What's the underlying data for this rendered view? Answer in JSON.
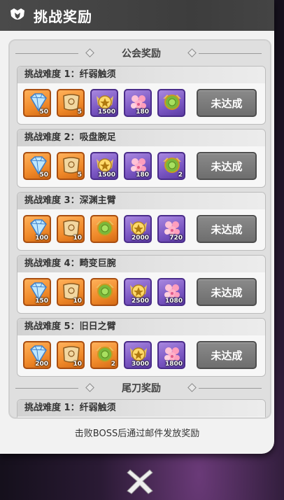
{
  "header": {
    "title": "挑战奖励",
    "icon": "guild-emblem-icon"
  },
  "sections": {
    "guild": "公会奖励",
    "last_hit": "尾刀奖励"
  },
  "cards": [
    {
      "title": "挑战难度 1：纤弱触须",
      "button": "未达成",
      "items": [
        {
          "type": "diamond",
          "q": "50",
          "c": "orange"
        },
        {
          "type": "scroll",
          "q": "5",
          "c": "orange"
        },
        {
          "type": "medal",
          "q": "1500",
          "c": "purple"
        },
        {
          "type": "flower",
          "q": "180",
          "c": "purple"
        },
        {
          "type": "chest",
          "q": "",
          "c": "purple"
        }
      ]
    },
    {
      "title": "挑战难度 2：吸盘腕足",
      "button": "未达成",
      "items": [
        {
          "type": "diamond",
          "q": "50",
          "c": "orange"
        },
        {
          "type": "scroll",
          "q": "5",
          "c": "orange"
        },
        {
          "type": "medal",
          "q": "1500",
          "c": "purple"
        },
        {
          "type": "flower",
          "q": "180",
          "c": "purple"
        },
        {
          "type": "chest",
          "q": "2",
          "c": "purple"
        }
      ]
    },
    {
      "title": "挑战难度 3：深渊主臂",
      "button": "未达成",
      "items": [
        {
          "type": "diamond",
          "q": "100",
          "c": "orange"
        },
        {
          "type": "scroll",
          "q": "10",
          "c": "orange"
        },
        {
          "type": "chest",
          "q": "",
          "c": "orange"
        },
        {
          "type": "medal",
          "q": "2000",
          "c": "purple"
        },
        {
          "type": "flower",
          "q": "720",
          "c": "purple"
        }
      ]
    },
    {
      "title": "挑战难度 4：畸变巨腕",
      "button": "未达成",
      "items": [
        {
          "type": "diamond",
          "q": "150",
          "c": "orange"
        },
        {
          "type": "scroll",
          "q": "10",
          "c": "orange"
        },
        {
          "type": "chest",
          "q": "",
          "c": "orange"
        },
        {
          "type": "medal",
          "q": "2500",
          "c": "purple"
        },
        {
          "type": "flower",
          "q": "1080",
          "c": "purple"
        }
      ]
    },
    {
      "title": "挑战难度 5：旧日之臂",
      "button": "未达成",
      "items": [
        {
          "type": "diamond",
          "q": "200",
          "c": "orange"
        },
        {
          "type": "scroll",
          "q": "10",
          "c": "orange"
        },
        {
          "type": "chest",
          "q": "2",
          "c": "orange"
        },
        {
          "type": "medal",
          "q": "3000",
          "c": "purple"
        },
        {
          "type": "flower",
          "q": "1800",
          "c": "purple"
        }
      ]
    }
  ],
  "last_hit_card": {
    "title": "挑战难度 1：纤弱触须"
  },
  "footer": {
    "note": "击败BOSS后通过邮件发放奖励"
  },
  "close": {
    "icon": "close-x-icon"
  }
}
